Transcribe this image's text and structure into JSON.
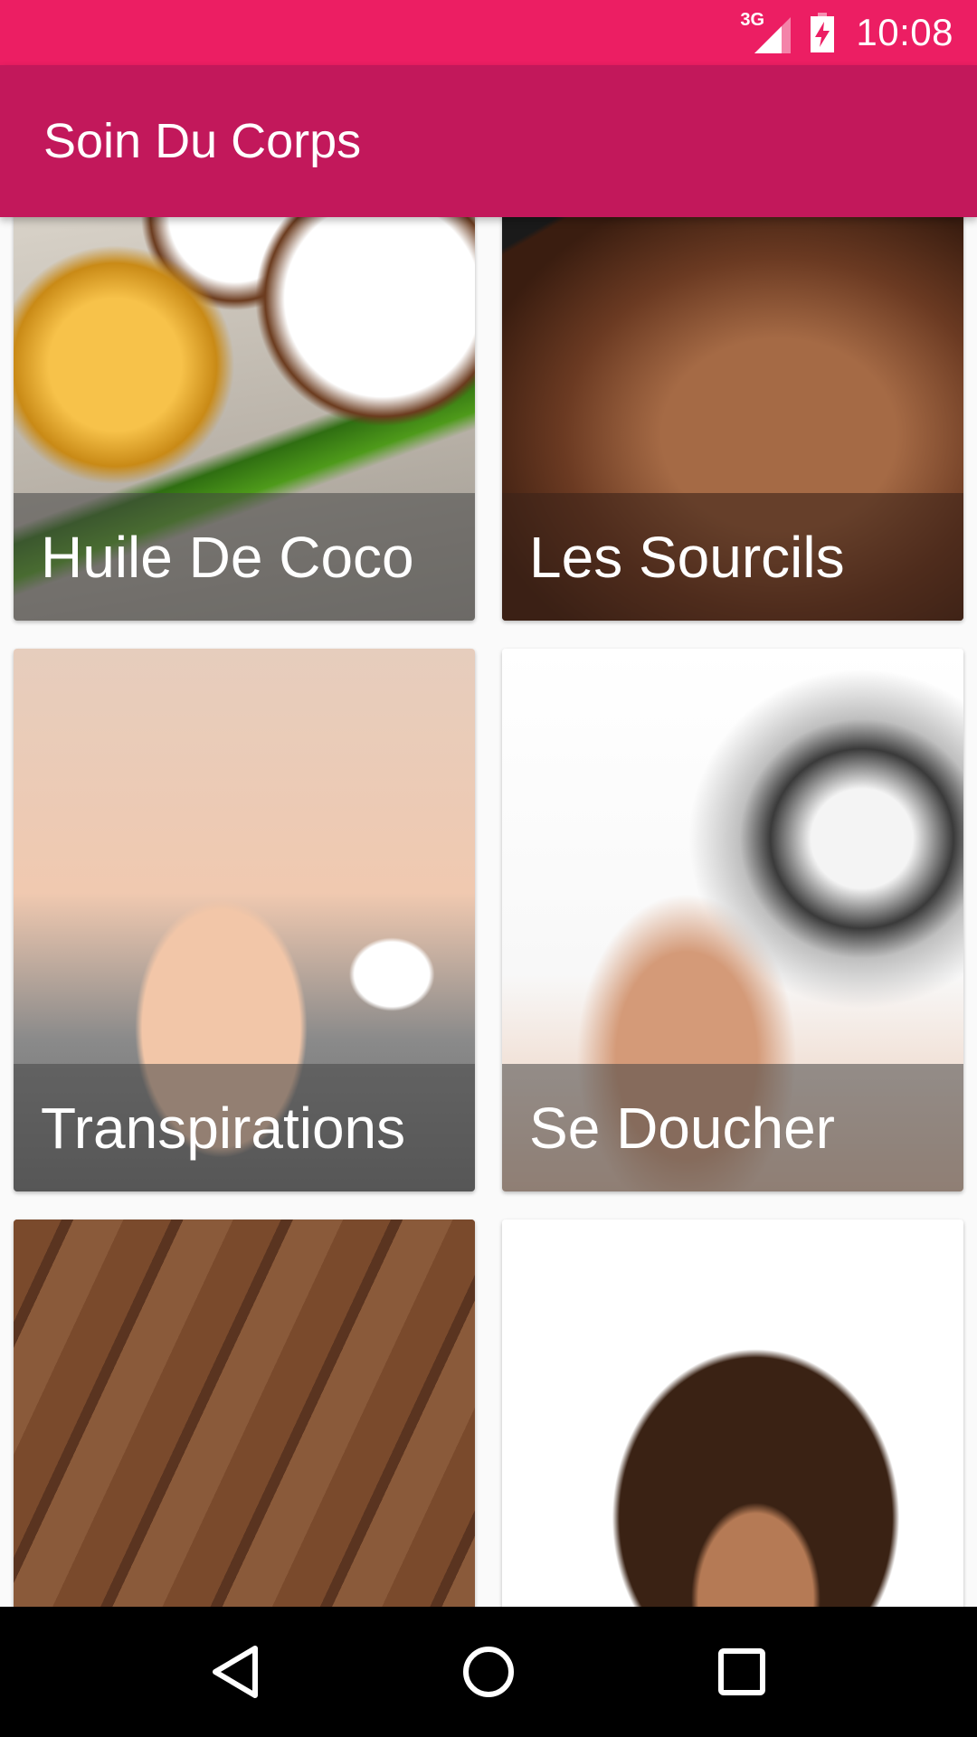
{
  "status_bar": {
    "network_type": "3G",
    "time": "10:08",
    "icons": [
      "signal-icon",
      "battery-charging-icon"
    ],
    "background": "#ec1e63"
  },
  "app_bar": {
    "title": "Soin Du Corps",
    "background": "#c2185b"
  },
  "grid": {
    "items": [
      {
        "label": "Huile De Coco"
      },
      {
        "label": "Les Sourcils"
      },
      {
        "label": "Transpirations"
      },
      {
        "label": "Se Doucher"
      },
      {
        "label": ""
      },
      {
        "label": ""
      }
    ]
  },
  "nav_bar": {
    "icons": [
      "back-icon",
      "home-icon",
      "recents-icon"
    ]
  }
}
